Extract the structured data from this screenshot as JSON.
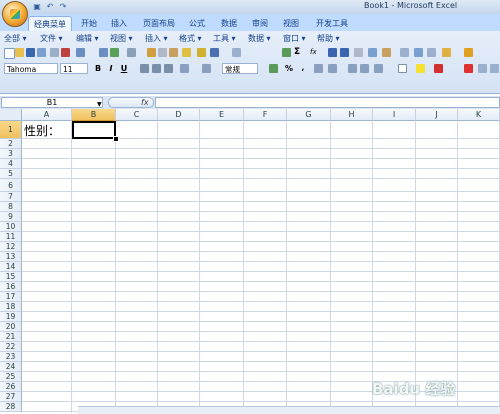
{
  "window": {
    "title": "Book1 - Microsoft Excel"
  },
  "quick_access": {
    "save_icon": "save-icon",
    "undo_icon": "undo-icon",
    "redo_icon": "redo-icon"
  },
  "ribbon_tabs": [
    "经典菜单",
    "开始",
    "插入",
    "页面布局",
    "公式",
    "数据",
    "审阅",
    "视图",
    "开发工具"
  ],
  "classic_menu": [
    "全部 ▾",
    "文件 ▾",
    "编辑 ▾",
    "视图 ▾",
    "插入 ▾",
    "格式 ▾",
    "工具 ▾",
    "数据 ▾",
    "窗口 ▾",
    "帮助 ▾"
  ],
  "font": {
    "name": "Tahoma",
    "size": "11",
    "bold": "B",
    "italic": "I",
    "underline": "U"
  },
  "number_format": "常规",
  "formula_bar": {
    "name_box": "B1",
    "fx": "fx",
    "value": ""
  },
  "columns": [
    "A",
    "B",
    "C",
    "D",
    "E",
    "F",
    "G",
    "H",
    "I",
    "J",
    "K"
  ],
  "rows": [
    "1",
    "2",
    "3",
    "4",
    "5",
    "6",
    "7",
    "8",
    "9",
    "10",
    "11",
    "12",
    "13",
    "14",
    "15",
    "16",
    "17",
    "18",
    "19",
    "20",
    "21",
    "22",
    "23",
    "24",
    "25",
    "26",
    "27",
    "28"
  ],
  "cells": {
    "A1": "性别："
  },
  "selected_cell": {
    "column": "B",
    "row": "1"
  },
  "watermark": "Baidu 经验"
}
